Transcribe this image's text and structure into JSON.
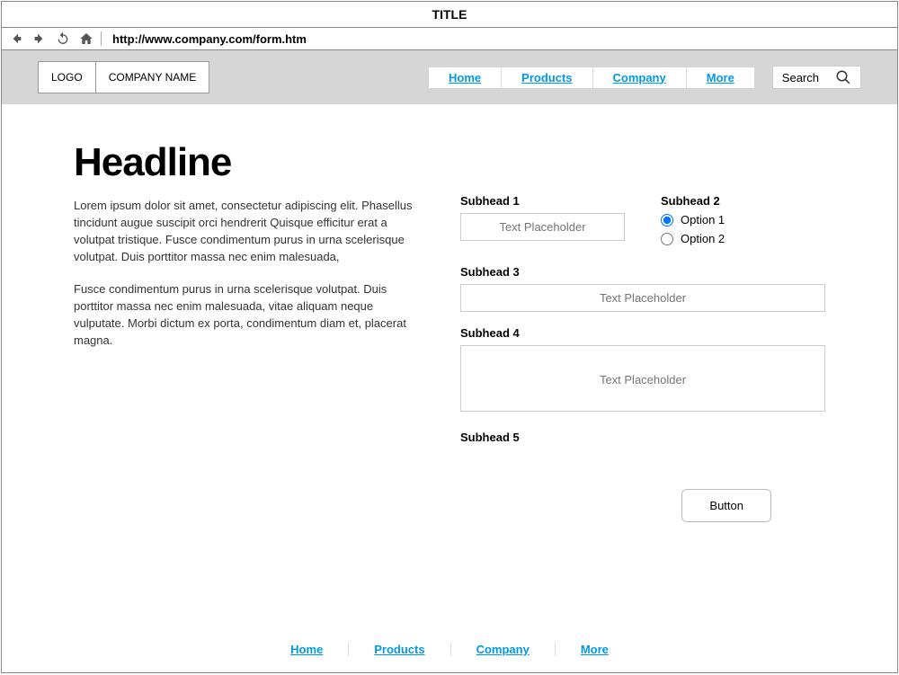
{
  "window": {
    "title": "TITLE"
  },
  "browser": {
    "url": "http://www.company.com/form.htm"
  },
  "header": {
    "logo": "LOGO",
    "company": "COMPANY NAME",
    "nav": [
      "Home",
      "Products",
      "Company",
      "More"
    ],
    "search_placeholder": "Search"
  },
  "main": {
    "headline": "Headline",
    "para1": "Lorem ipsum dolor sit amet, consectetur adipiscing elit. Phasellus tincidunt augue suscipit orci hendrerit Quisque efficitur erat a volutpat tristique. Fusce condimentum purus in urna scelerisque volutpat. Duis porttitor massa nec enim malesuada,",
    "para2": "Fusce condimentum purus in urna scelerisque volutpat. Duis porttitor massa nec enim malesuada, vitae aliquam neque vulputate. Morbi dictum ex porta, condimentum diam et, placerat magna."
  },
  "form": {
    "subhead1": "Subhead 1",
    "subhead2": "Subhead 2",
    "subhead3": "Subhead 3",
    "subhead4": "Subhead 4",
    "subhead5": "Subhead 5",
    "placeholder": "Text Placeholder",
    "option1": "Option 1",
    "option2": "Option 2",
    "button": "Button"
  },
  "footer": {
    "nav": [
      "Home",
      "Products",
      "Company",
      "More"
    ]
  }
}
